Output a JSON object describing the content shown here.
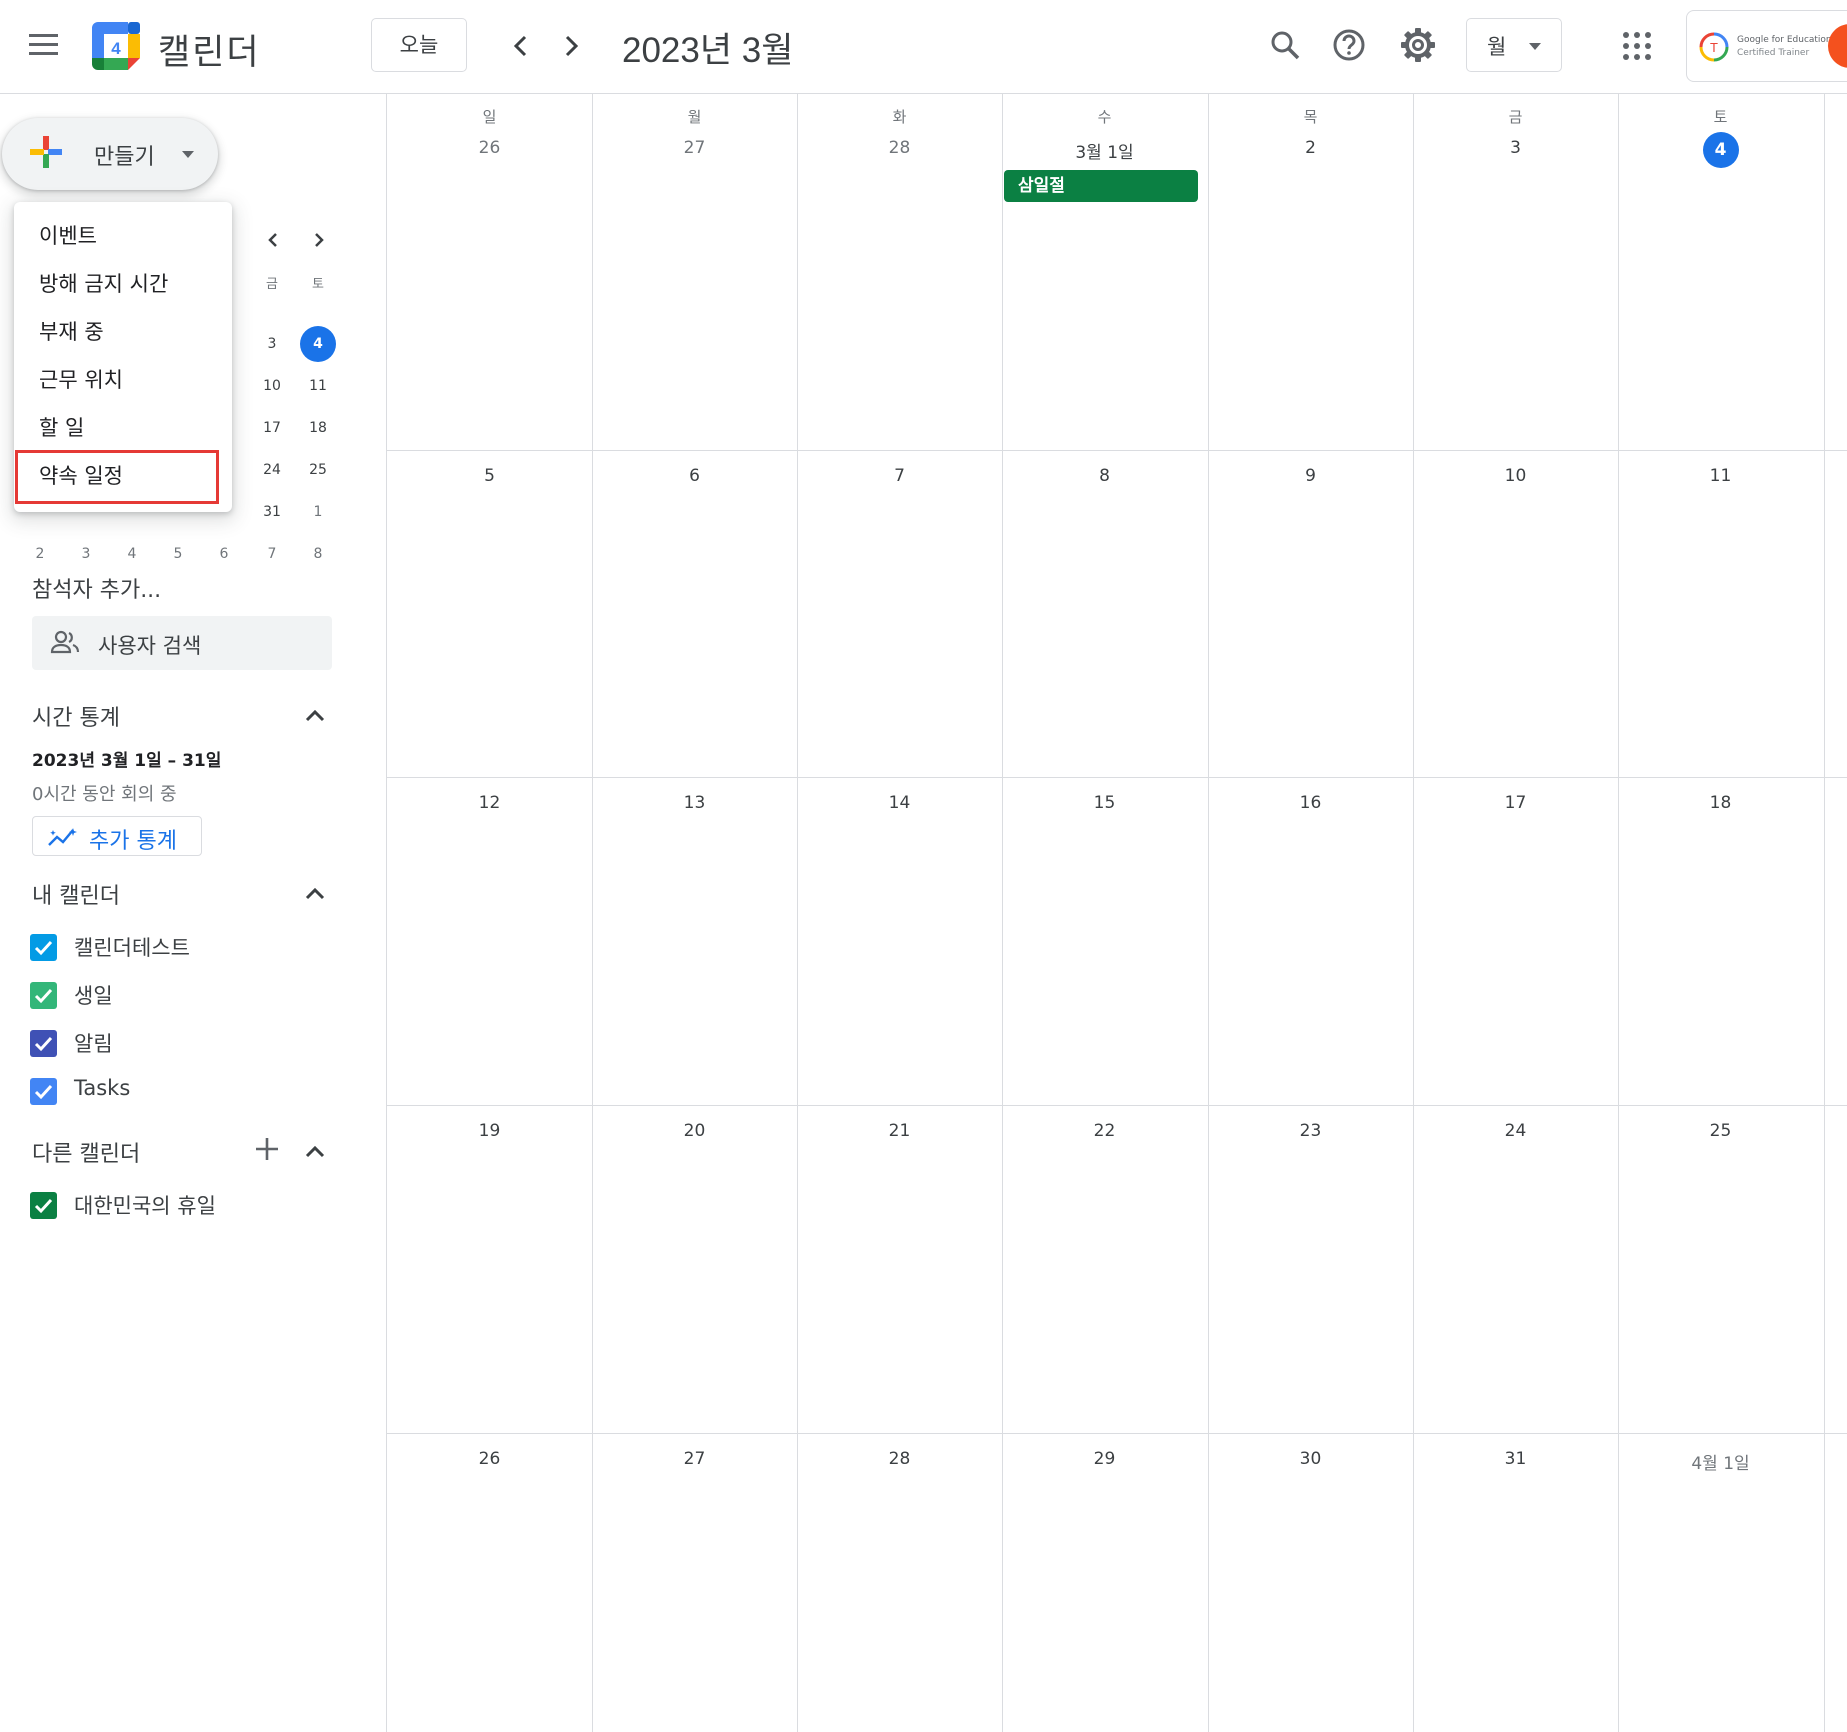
{
  "header": {
    "app_title": "캘린더",
    "logo_day": "4",
    "today_label": "오늘",
    "month_title": "2023년 3월",
    "view_label": "월",
    "badge_line1": "Google for Education",
    "badge_line2": "Certified Trainer",
    "badge_letter": "T"
  },
  "create": {
    "label": "만들기"
  },
  "create_menu": {
    "items": [
      {
        "label": "이벤트"
      },
      {
        "label": "방해 금지 시간"
      },
      {
        "label": "부재 중"
      },
      {
        "label": "근무 위치"
      },
      {
        "label": "할 일"
      },
      {
        "label": "약속 일정"
      }
    ],
    "highlighted": "약속 일정"
  },
  "mini_calendar": {
    "dow": [
      "금",
      "토"
    ],
    "visible_cells": [
      [
        "3",
        "4"
      ],
      [
        "10",
        "11"
      ],
      [
        "17",
        "18"
      ],
      [
        "24",
        "25"
      ],
      [
        "31",
        "1"
      ]
    ],
    "last_row": [
      "2",
      "3",
      "4",
      "5",
      "6",
      "7",
      "8"
    ],
    "today": "4"
  },
  "people": {
    "label": "참석자 추가...",
    "search_placeholder": "사용자 검색"
  },
  "time_stats": {
    "title": "시간 통계",
    "range": "2023년 3월 1일 – 31일",
    "summary": "0시간 동안 회의 중",
    "more_button": "추가 통계"
  },
  "my_calendars": {
    "title": "내 캘린더",
    "items": [
      {
        "label": "캘린더테스트",
        "color": "#039be5",
        "checked": true
      },
      {
        "label": "생일",
        "color": "#33b679",
        "checked": true
      },
      {
        "label": "알림",
        "color": "#3f51b5",
        "checked": true
      },
      {
        "label": "Tasks",
        "color": "#4285f4",
        "checked": true
      }
    ]
  },
  "other_calendars": {
    "title": "다른 캘린더",
    "items": [
      {
        "label": "대한민국의 휴일",
        "color": "#0b8043",
        "checked": true
      }
    ]
  },
  "month_grid": {
    "dow": [
      "일",
      "월",
      "화",
      "수",
      "목",
      "금",
      "토"
    ],
    "weeks": [
      [
        "26",
        "27",
        "28",
        "3월 1일",
        "2",
        "3",
        "4"
      ],
      [
        "5",
        "6",
        "7",
        "8",
        "9",
        "10",
        "11"
      ],
      [
        "12",
        "13",
        "14",
        "15",
        "16",
        "17",
        "18"
      ],
      [
        "19",
        "20",
        "21",
        "22",
        "23",
        "24",
        "25"
      ],
      [
        "26",
        "27",
        "28",
        "29",
        "30",
        "31",
        "4월 1일"
      ]
    ],
    "today": "4",
    "events": [
      {
        "date": "3월 1일",
        "title": "삼일절",
        "color": "#0b8043"
      }
    ]
  },
  "colors": {
    "accent": "#1a73e8",
    "holiday": "#0b8043",
    "highlight_border": "#e53935"
  }
}
